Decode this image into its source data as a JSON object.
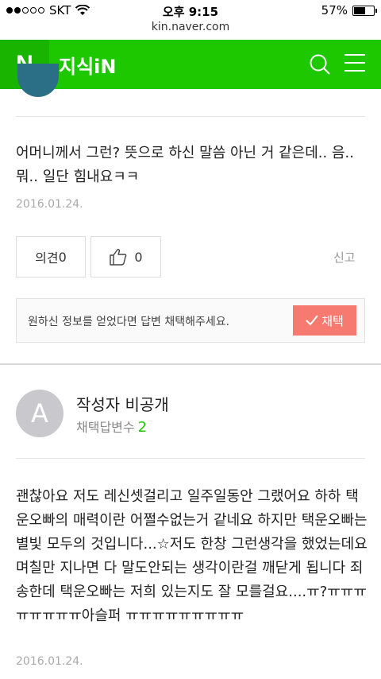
{
  "status": {
    "carrier": "SKT",
    "time": "오후 9:15",
    "battery": "57%",
    "battery_level": 0.57
  },
  "url": "kin.naver.com",
  "header": {
    "logo": "N",
    "brand": "지식iN"
  },
  "prev_answer": {
    "text": "어머니께서 그런? 뜻으로 하신 말씀 아닌 거 같은데.. 음.. 뭐.. 일단 힘내요ㅋㅋ",
    "date": "2016.01.24.",
    "opinion_label": "의견",
    "opinion_count": "0",
    "like_count": "0",
    "report_label": "신고",
    "adopt_message": "원하신 정보를 얻었다면 답변 채택해주세요.",
    "adopt_button": "채택"
  },
  "next_answer": {
    "avatar_letter": "A",
    "author": "작성자 비공개",
    "adopted_label": "채택답변수",
    "adopted_count": "2",
    "text": "괜찮아요 저도 레신셋걸리고 일주일동안 그랬어요 하하 택운오빠의 매력이란 어쩔수없는거 같네요 하지만 택운오빠는 별빛 모두의 것입니다...☆저도 한창 그런생각을 했었는데요 며칠만 지나면 다 말도안되는 생각이란걸 깨닫게 됩니다 죄송한데 택운오빠는 저희 있는지도 잘 모를걸요....ㅠ?ㅠㅠㅠㅠㅠㅠㅠㅠ아슬퍼 ㅠㅠㅠㅠㅠㅠㅠㅠㅠ",
    "date": "2016.01.24."
  }
}
